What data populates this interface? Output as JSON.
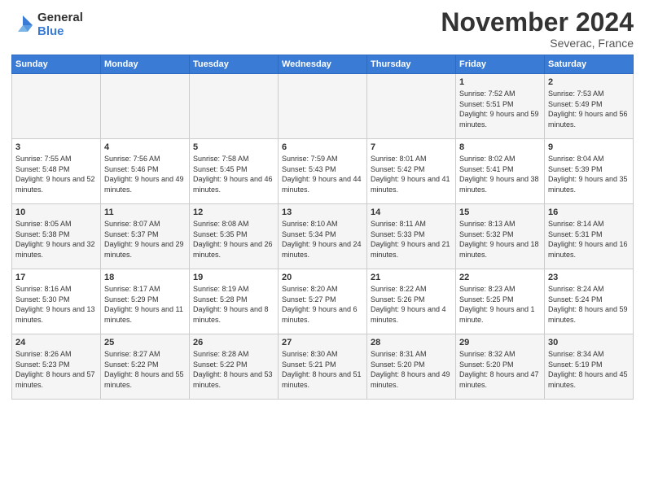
{
  "header": {
    "logo_general": "General",
    "logo_blue": "Blue",
    "title": "November 2024",
    "location": "Severac, France"
  },
  "days_of_week": [
    "Sunday",
    "Monday",
    "Tuesday",
    "Wednesday",
    "Thursday",
    "Friday",
    "Saturday"
  ],
  "weeks": [
    [
      {
        "day": "",
        "info": ""
      },
      {
        "day": "",
        "info": ""
      },
      {
        "day": "",
        "info": ""
      },
      {
        "day": "",
        "info": ""
      },
      {
        "day": "",
        "info": ""
      },
      {
        "day": "1",
        "info": "Sunrise: 7:52 AM\nSunset: 5:51 PM\nDaylight: 9 hours and 59 minutes."
      },
      {
        "day": "2",
        "info": "Sunrise: 7:53 AM\nSunset: 5:49 PM\nDaylight: 9 hours and 56 minutes."
      }
    ],
    [
      {
        "day": "3",
        "info": "Sunrise: 7:55 AM\nSunset: 5:48 PM\nDaylight: 9 hours and 52 minutes."
      },
      {
        "day": "4",
        "info": "Sunrise: 7:56 AM\nSunset: 5:46 PM\nDaylight: 9 hours and 49 minutes."
      },
      {
        "day": "5",
        "info": "Sunrise: 7:58 AM\nSunset: 5:45 PM\nDaylight: 9 hours and 46 minutes."
      },
      {
        "day": "6",
        "info": "Sunrise: 7:59 AM\nSunset: 5:43 PM\nDaylight: 9 hours and 44 minutes."
      },
      {
        "day": "7",
        "info": "Sunrise: 8:01 AM\nSunset: 5:42 PM\nDaylight: 9 hours and 41 minutes."
      },
      {
        "day": "8",
        "info": "Sunrise: 8:02 AM\nSunset: 5:41 PM\nDaylight: 9 hours and 38 minutes."
      },
      {
        "day": "9",
        "info": "Sunrise: 8:04 AM\nSunset: 5:39 PM\nDaylight: 9 hours and 35 minutes."
      }
    ],
    [
      {
        "day": "10",
        "info": "Sunrise: 8:05 AM\nSunset: 5:38 PM\nDaylight: 9 hours and 32 minutes."
      },
      {
        "day": "11",
        "info": "Sunrise: 8:07 AM\nSunset: 5:37 PM\nDaylight: 9 hours and 29 minutes."
      },
      {
        "day": "12",
        "info": "Sunrise: 8:08 AM\nSunset: 5:35 PM\nDaylight: 9 hours and 26 minutes."
      },
      {
        "day": "13",
        "info": "Sunrise: 8:10 AM\nSunset: 5:34 PM\nDaylight: 9 hours and 24 minutes."
      },
      {
        "day": "14",
        "info": "Sunrise: 8:11 AM\nSunset: 5:33 PM\nDaylight: 9 hours and 21 minutes."
      },
      {
        "day": "15",
        "info": "Sunrise: 8:13 AM\nSunset: 5:32 PM\nDaylight: 9 hours and 18 minutes."
      },
      {
        "day": "16",
        "info": "Sunrise: 8:14 AM\nSunset: 5:31 PM\nDaylight: 9 hours and 16 minutes."
      }
    ],
    [
      {
        "day": "17",
        "info": "Sunrise: 8:16 AM\nSunset: 5:30 PM\nDaylight: 9 hours and 13 minutes."
      },
      {
        "day": "18",
        "info": "Sunrise: 8:17 AM\nSunset: 5:29 PM\nDaylight: 9 hours and 11 minutes."
      },
      {
        "day": "19",
        "info": "Sunrise: 8:19 AM\nSunset: 5:28 PM\nDaylight: 9 hours and 8 minutes."
      },
      {
        "day": "20",
        "info": "Sunrise: 8:20 AM\nSunset: 5:27 PM\nDaylight: 9 hours and 6 minutes."
      },
      {
        "day": "21",
        "info": "Sunrise: 8:22 AM\nSunset: 5:26 PM\nDaylight: 9 hours and 4 minutes."
      },
      {
        "day": "22",
        "info": "Sunrise: 8:23 AM\nSunset: 5:25 PM\nDaylight: 9 hours and 1 minute."
      },
      {
        "day": "23",
        "info": "Sunrise: 8:24 AM\nSunset: 5:24 PM\nDaylight: 8 hours and 59 minutes."
      }
    ],
    [
      {
        "day": "24",
        "info": "Sunrise: 8:26 AM\nSunset: 5:23 PM\nDaylight: 8 hours and 57 minutes."
      },
      {
        "day": "25",
        "info": "Sunrise: 8:27 AM\nSunset: 5:22 PM\nDaylight: 8 hours and 55 minutes."
      },
      {
        "day": "26",
        "info": "Sunrise: 8:28 AM\nSunset: 5:22 PM\nDaylight: 8 hours and 53 minutes."
      },
      {
        "day": "27",
        "info": "Sunrise: 8:30 AM\nSunset: 5:21 PM\nDaylight: 8 hours and 51 minutes."
      },
      {
        "day": "28",
        "info": "Sunrise: 8:31 AM\nSunset: 5:20 PM\nDaylight: 8 hours and 49 minutes."
      },
      {
        "day": "29",
        "info": "Sunrise: 8:32 AM\nSunset: 5:20 PM\nDaylight: 8 hours and 47 minutes."
      },
      {
        "day": "30",
        "info": "Sunrise: 8:34 AM\nSunset: 5:19 PM\nDaylight: 8 hours and 45 minutes."
      }
    ]
  ]
}
